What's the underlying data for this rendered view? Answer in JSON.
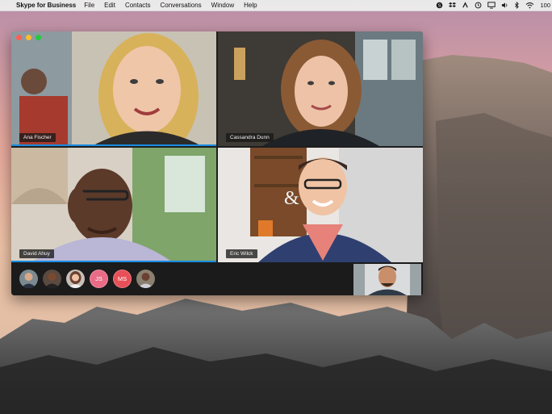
{
  "menubar": {
    "app_name": "Skype for Business",
    "items": [
      "File",
      "Edit",
      "Contacts",
      "Conversations",
      "Window",
      "Help"
    ],
    "battery": "100"
  },
  "window": {
    "participants": [
      {
        "name": "Ana Fischer",
        "active": true
      },
      {
        "name": "Cassandra Dunn",
        "active": false
      },
      {
        "name": "David Ahuy",
        "active": true
      },
      {
        "name": "Eric Wilck",
        "active": false
      }
    ],
    "avatars": [
      {
        "type": "photo",
        "name": "participant-1"
      },
      {
        "type": "photo",
        "name": "participant-2"
      },
      {
        "type": "photo",
        "name": "participant-3"
      },
      {
        "type": "initials",
        "initials": "JS"
      },
      {
        "type": "initials",
        "initials": "MS"
      },
      {
        "type": "photo",
        "name": "participant-6"
      }
    ]
  },
  "colors": {
    "accent": "#1a8ce0",
    "initials_js": "#e96b86",
    "initials_ms": "#e84f57"
  }
}
